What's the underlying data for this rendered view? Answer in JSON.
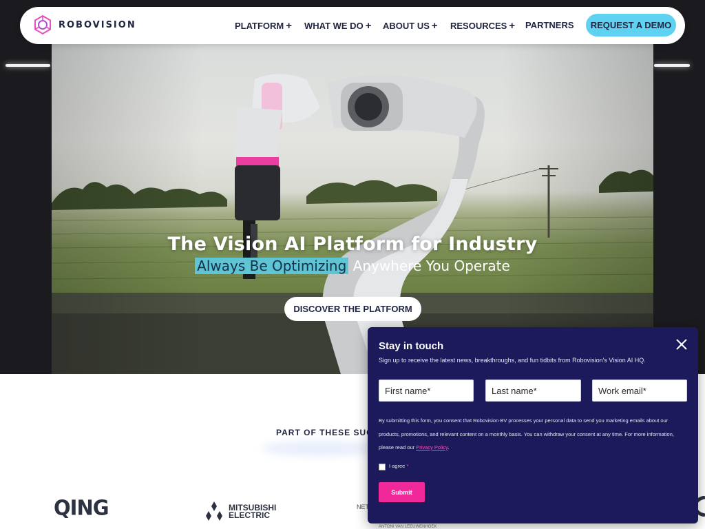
{
  "brand": {
    "name": "ROBOVISION",
    "accent": "#e54fc0"
  },
  "nav": {
    "items": [
      {
        "label": "PLATFORM",
        "suffix": "+"
      },
      {
        "label": "WHAT WE DO",
        "suffix": "+"
      },
      {
        "label": "ABOUT US",
        "suffix": "+"
      },
      {
        "label": "RESOURCES",
        "suffix": "+"
      },
      {
        "label": "PARTNERS",
        "suffix": ""
      }
    ],
    "cta_label": "REQUEST A DEMO",
    "cta_color": "#5fd2f2"
  },
  "hero": {
    "title": "The Vision AI Platform for Industry",
    "subtitle_highlight": "Always Be Optimizing",
    "subtitle_rest": "Anywhere You Operate",
    "button_label": "DISCOVER THE PLATFORM",
    "highlight_color": "#5fc4d3"
  },
  "partners": {
    "heading_visible": "PART OF THESE SUCC",
    "logos": [
      {
        "name": "qing-logo",
        "text": "QING"
      },
      {
        "name": "mitsubishi-logo",
        "line1": "MITSUBISHI",
        "line2": "ELECTRIC"
      },
      {
        "name": "net-logo",
        "text": "NET"
      }
    ]
  },
  "popup": {
    "title": "Stay in touch",
    "description": "Sign up to receive the latest news, breakthroughs, and fun tidbits from Robovision's Vision AI HQ.",
    "fields": {
      "first_name_placeholder": "First name*",
      "last_name_placeholder": "Last name*",
      "email_placeholder": "Work email*"
    },
    "consent_text": "By submitting this form, you consent that Robovision BV processes your personal data to send you marketing emails about our products, promotions, and relevant content on a monthly basis. You can withdraw your consent at any time. For more information, please read our",
    "privacy_link": "Privacy Policy",
    "consent_end": ".",
    "agree_label": "I agree",
    "agree_required": "*",
    "submit_label": "Submit",
    "background": "#1c1a5a",
    "submit_color": "#f0299a"
  },
  "footnote_partial": "ANTONI VAN LEEUWENHOEK"
}
